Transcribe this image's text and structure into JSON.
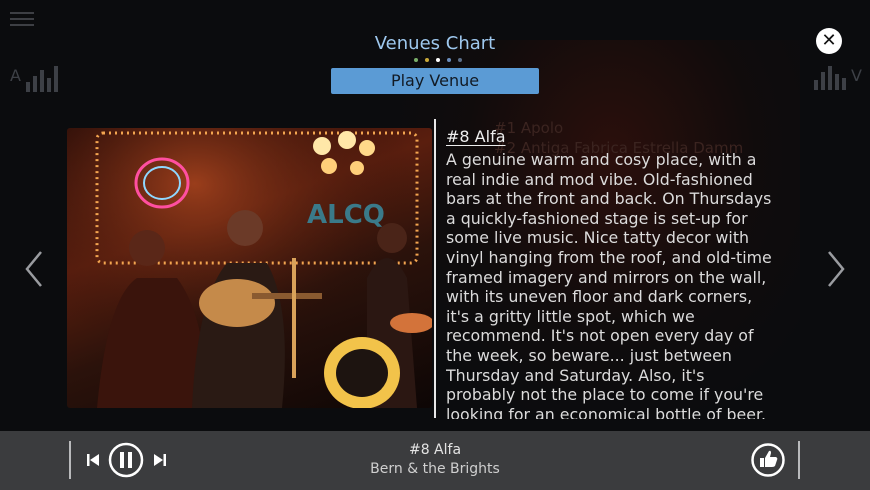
{
  "header": {
    "title": "Venues Chart",
    "play_label": "Play Venue",
    "dots": [
      "#7ab06a",
      "#c9a93a",
      "#ffffff",
      "#6a8dbd",
      "#5c6f8a"
    ],
    "left_letter": "A",
    "right_letter": "V",
    "close_icon": "close-icon"
  },
  "background_list": [
    "#1 Apolo",
    "#2 Antiga Fabrica Estrella Damm"
  ],
  "venue": {
    "title": "#8 Alfa",
    "description": "A genuine warm and cosy place, with a\nreal indie and mod vibe. Old-fashioned\nbars at the front and back. On Thursdays\na quickly-fashioned stage is set-up for\nsome live music. Nice tatty decor with\nvinyl hanging from the roof, and old-time\nframed imagery and mirrors on the wall,\nwith its uneven floor and dark corners,\nit's a gritty little spot, which we\nrecommend. It's not open every day of\nthe week, so beware... just between\nThursday and Saturday. Also, it's\nprobably not the place to come if you're\nlooking for an economical bottle of beer."
  },
  "player": {
    "now_title": "#8 Alfa",
    "now_subtitle": "Bern & the Brights",
    "state": "playing"
  },
  "colors": {
    "accent": "#5b9bd5",
    "title": "#9ec8ee",
    "player_bg": "#3b3c3e"
  }
}
